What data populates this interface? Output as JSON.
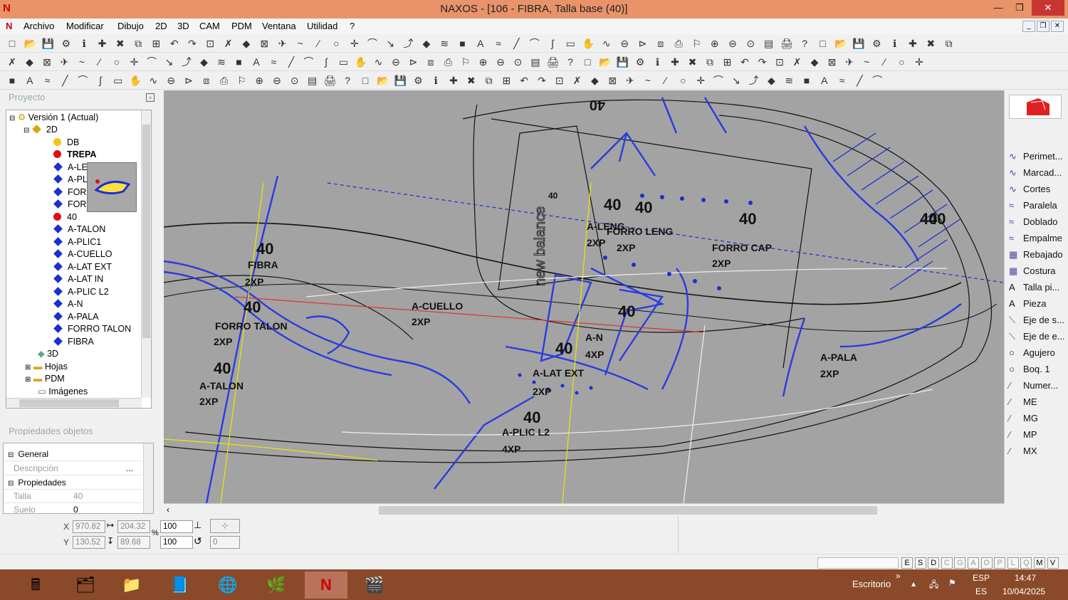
{
  "app": {
    "title": "NAXOS - [106 - FIBRA, Talla base (40)]",
    "logo": "N"
  },
  "menu": [
    "Archivo",
    "Modificar",
    "Dibujo",
    "2D",
    "3D",
    "CAM",
    "PDM",
    "Ventana",
    "Utilidad",
    "?"
  ],
  "project_panel": {
    "title": "Proyecto",
    "tree": [
      {
        "label": "Versión 1 (Actual)",
        "icon": "folder-version-icon"
      },
      {
        "label": "2D",
        "icon": "diamond-icon"
      },
      {
        "label": "DB",
        "icon": "yellow-dot-icon"
      },
      {
        "label": "TREPA",
        "icon": "red-dot-icon"
      },
      {
        "label": "A-LE",
        "icon": "blue-diamond-icon"
      },
      {
        "label": "A-PL",
        "icon": "blue-diamond-icon"
      },
      {
        "label": "FORI",
        "icon": "blue-diamond-icon"
      },
      {
        "label": "FORI",
        "icon": "blue-diamond-icon"
      },
      {
        "label": "40",
        "icon": "red-dot-icon"
      },
      {
        "label": "A-TALON",
        "icon": "blue-diamond-icon"
      },
      {
        "label": "A-PLIC1",
        "icon": "blue-diamond-icon"
      },
      {
        "label": "A-CUELLO",
        "icon": "blue-diamond-icon"
      },
      {
        "label": "A-LAT EXT",
        "icon": "blue-diamond-icon"
      },
      {
        "label": "A-LAT IN",
        "icon": "blue-diamond-icon"
      },
      {
        "label": "A-PLIC L2",
        "icon": "blue-diamond-icon"
      },
      {
        "label": "A-N",
        "icon": "blue-diamond-icon"
      },
      {
        "label": "A-PALA",
        "icon": "blue-diamond-icon"
      },
      {
        "label": "FORRO TALON",
        "icon": "blue-diamond-icon"
      },
      {
        "label": "FIBRA",
        "icon": "blue-diamond-icon"
      },
      {
        "label": "3D",
        "icon": "3d-icon"
      },
      {
        "label": "Hojas",
        "icon": "folder-icon"
      },
      {
        "label": "PDM",
        "icon": "folder-icon"
      },
      {
        "label": "Imágenes",
        "icon": "images-icon"
      }
    ]
  },
  "properties_panel": {
    "title": "Propiedades objetos",
    "rows": [
      {
        "label": "General",
        "value": "",
        "group": true
      },
      {
        "label": "Descripción",
        "value": "...",
        "group": false
      },
      {
        "label": "Propiedades",
        "value": "",
        "group": true
      },
      {
        "label": "Talla",
        "value": "40",
        "group": false
      },
      {
        "label": "Suelo",
        "value": "0",
        "group": false
      }
    ]
  },
  "right_tools": [
    {
      "label": "Perimet...",
      "icon": "curve-icon"
    },
    {
      "label": "Marcad...",
      "icon": "curve-icon"
    },
    {
      "label": "Cortes",
      "icon": "curve-icon"
    },
    {
      "label": "Paralela",
      "icon": "parallel-icon"
    },
    {
      "label": "Doblado",
      "icon": "fold-icon"
    },
    {
      "label": "Empalme",
      "icon": "join-icon"
    },
    {
      "label": "Rebajado",
      "icon": "skive-icon"
    },
    {
      "label": "Costura",
      "icon": "seam-icon"
    },
    {
      "label": "Talla pi...",
      "icon": "text-a-icon"
    },
    {
      "label": "Pieza",
      "icon": "text-a-icon"
    },
    {
      "label": "Eje de s...",
      "icon": "axis-icon"
    },
    {
      "label": "Eje de e...",
      "icon": "axis-icon"
    },
    {
      "label": "Agujero",
      "icon": "circle-icon"
    },
    {
      "label": "Boq. 1",
      "icon": "circle-icon"
    },
    {
      "label": "Numer...",
      "icon": "line-icon"
    },
    {
      "label": "ME",
      "icon": "line-icon"
    },
    {
      "label": "MG",
      "icon": "line-icon"
    },
    {
      "label": "MP",
      "icon": "line-icon"
    },
    {
      "label": "MX",
      "icon": "line-icon"
    }
  ],
  "coords": {
    "x_label": "X",
    "x": "970.82",
    "dx": "204.32",
    "scale_x": "100",
    "y_label": "Y",
    "y": "130.52",
    "dy": "89.68",
    "scale_y": "100",
    "percent": "%",
    "angle": "0"
  },
  "snap_modes": [
    "E",
    "S",
    "D",
    "C",
    "G",
    "A",
    "O",
    "P",
    "L",
    "Q",
    "M",
    "V"
  ],
  "cad_labels": [
    {
      "text": "40"
    },
    {
      "text": "40"
    },
    {
      "text": "40"
    },
    {
      "text": "40"
    },
    {
      "text": "40"
    },
    {
      "text": "A-LENG"
    },
    {
      "text": "2XP"
    },
    {
      "text": "FORRO LENG"
    },
    {
      "text": "2XP"
    },
    {
      "text": "FORRO CAP"
    },
    {
      "text": "2XP"
    },
    {
      "text": "40"
    },
    {
      "text": "FIBRA"
    },
    {
      "text": "2XP"
    },
    {
      "text": "40"
    },
    {
      "text": "FORRO TALON"
    },
    {
      "text": "2XP"
    },
    {
      "text": "A-CUELLO"
    },
    {
      "text": "2XP"
    },
    {
      "text": "40"
    },
    {
      "text": "A-N"
    },
    {
      "text": "4XP"
    },
    {
      "text": "40"
    },
    {
      "text": "A-LAT EXT"
    },
    {
      "text": "2XP"
    },
    {
      "text": "40"
    },
    {
      "text": "A-TALON"
    },
    {
      "text": "2XP"
    },
    {
      "text": "40"
    },
    {
      "text": "A-PLIC L2"
    },
    {
      "text": "4XP"
    },
    {
      "text": "A-PALA"
    },
    {
      "text": "2XP"
    },
    {
      "text": "40"
    },
    {
      "text": "40"
    },
    {
      "text": "new balance"
    }
  ],
  "taskbar": {
    "desktop": "Escritorio",
    "lang_top": "ESP",
    "lang_bottom": "ES",
    "time": "14:47",
    "date": "10/04/2025"
  },
  "colors": {
    "titlebar": "#e9936a",
    "canvas": "#a3a3a3",
    "taskbar": "#8a4a2a",
    "piece_blue": "#2a3be0"
  }
}
